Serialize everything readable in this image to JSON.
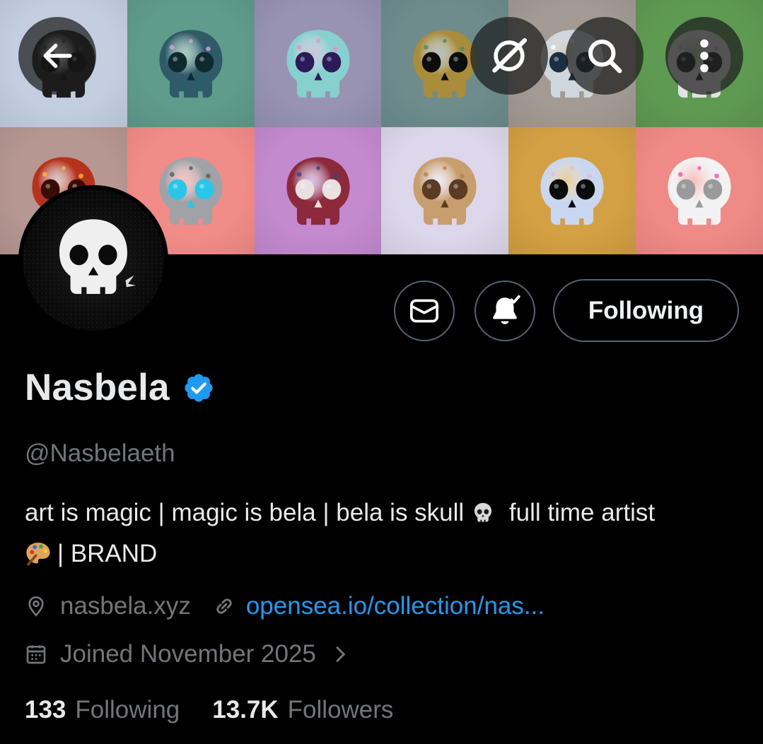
{
  "banner": {
    "tiles": [
      {
        "bg": "#c3cfe1",
        "skull": "#1d1d1d",
        "eye": "#050505",
        "accent": "#3a3a3a"
      },
      {
        "bg": "#5f9c8c",
        "skull": "#2f5b68",
        "eye": "#0f2a2f",
        "accent": "#d8a4e0"
      },
      {
        "bg": "#9892b3",
        "skull": "#86d0cf",
        "eye": "#2d1a58",
        "accent": "#f28bc0"
      },
      {
        "bg": "#6e8c8c",
        "skull": "#a98d3a",
        "eye": "#0d0d0d",
        "accent": "#4f8a6a"
      },
      {
        "bg": "#a39b93",
        "skull": "#cfd6dc",
        "eye": "#1c2e42",
        "accent": "#ffffff"
      },
      {
        "bg": "#5f9a52",
        "skull": "#e2e2e2",
        "eye": "#2a2a2a",
        "accent": "#bdbdbd"
      },
      {
        "bg": "#b69792",
        "skull": "#b5331c",
        "eye": "#3a0c06",
        "accent": "#ffb347"
      },
      {
        "bg": "#f28c88",
        "skull": "#9fa3a8",
        "eye": "#28c6e8",
        "accent": "#555b60"
      },
      {
        "bg": "#c38acf",
        "skull": "#8c2a3c",
        "eye": "#e9e1e1",
        "accent": "#2d4a8c"
      },
      {
        "bg": "#dcd7ea",
        "skull": "#c99e6e",
        "eye": "#5b3b23",
        "accent": "#b38253"
      },
      {
        "bg": "#d3a043",
        "skull": "#c8d7ef",
        "eye": "#0b0b0b",
        "accent": "#e6b9de"
      },
      {
        "bg": "#f08a86",
        "skull": "#f2f2f2",
        "eye": "#9a9a9a",
        "accent": "#e85aa0"
      }
    ]
  },
  "nav": {
    "back_icon": "arrow-left-icon",
    "grok_icon": "slash-circle-icon",
    "search_icon": "search-icon",
    "more_icon": "more-vertical-icon"
  },
  "actions": {
    "message_icon": "envelope-icon",
    "notify_icon": "bell-check-icon",
    "follow_label": "Following"
  },
  "profile": {
    "name": "Nasbela",
    "handle": "@Nasbelaeth",
    "bio_part1": "art is magic | magic is bela | bela is skull",
    "bio_skull_emoji": "💀",
    "bio_part2": "full time artist",
    "bio_palette_emoji": "🎨",
    "bio_part3": "| BRAND",
    "location": "nasbela.xyz",
    "website": "opensea.io/collection/nas...",
    "joined": "Joined November 2025"
  },
  "stats": {
    "following_count": "133",
    "following_label": "Following",
    "followers_count": "13.7K",
    "followers_label": "Followers"
  },
  "colors": {
    "accent": "#1d9bf0",
    "muted": "#71767b",
    "border": "#536471"
  }
}
